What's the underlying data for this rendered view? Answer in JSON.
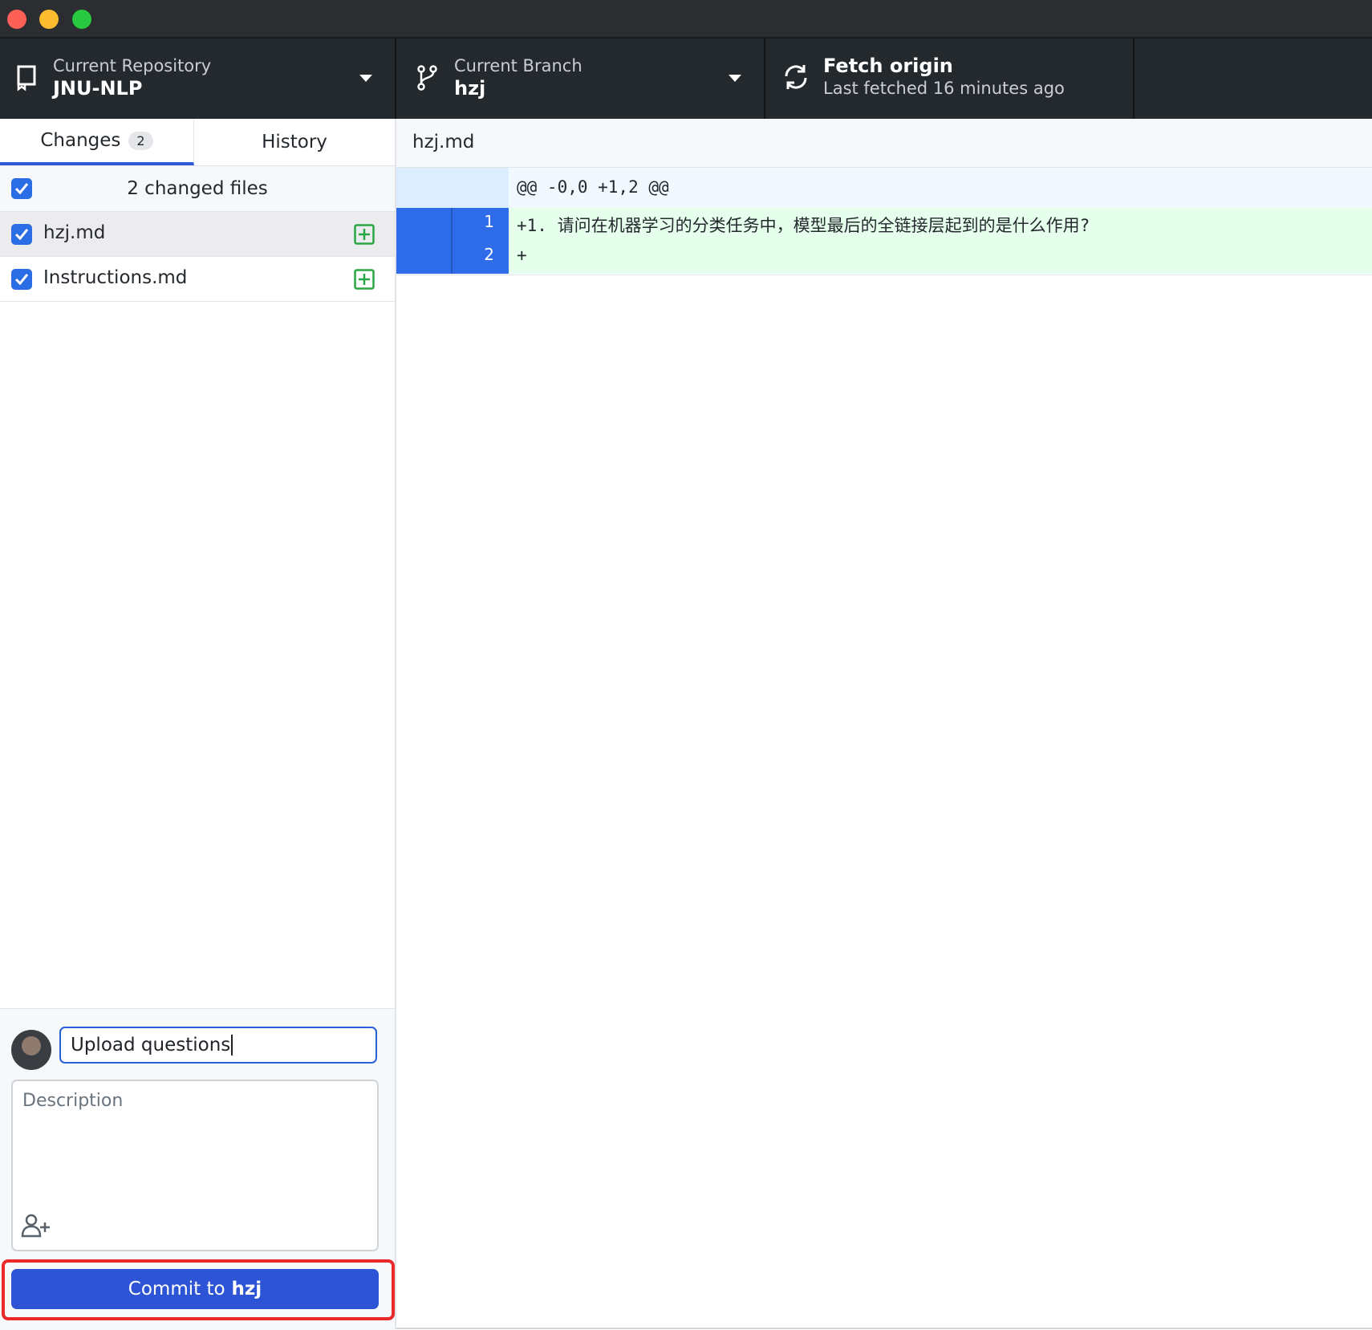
{
  "toolbar": {
    "repository": {
      "caption": "Current Repository",
      "value": "JNU-NLP",
      "icon": "repo-icon"
    },
    "branch": {
      "caption": "Current Branch",
      "value": "hzj",
      "icon": "branch-icon"
    },
    "fetch": {
      "title": "Fetch origin",
      "subtitle": "Last fetched 16 minutes ago",
      "icon": "sync-icon"
    }
  },
  "sidebar": {
    "tabs": [
      {
        "label": "Changes",
        "badge": "2",
        "active": true
      },
      {
        "label": "History",
        "active": false
      }
    ],
    "changes_header": "2 changed files",
    "files": [
      {
        "name": "hzj.md",
        "status": "added",
        "checked": true,
        "selected": true
      },
      {
        "name": "Instructions.md",
        "status": "added",
        "checked": true,
        "selected": false
      }
    ]
  },
  "commit": {
    "summary_value": "Upload questions",
    "description_placeholder": "Description",
    "button_prefix": "Commit to",
    "button_branch": "hzj"
  },
  "diff": {
    "filename": "hzj.md",
    "hunk_header": "@@ -0,0 +1,2 @@",
    "lines": [
      {
        "new_line": "1",
        "text": "+1. 请问在机器学习的分类任务中，模型最后的全链接层起到的是什么作用?"
      },
      {
        "new_line": "2",
        "text": "+"
      }
    ]
  },
  "colors": {
    "toolbar_bg": "#24292e",
    "accent_blue": "#2c54d4",
    "added_green": "#28a745",
    "diff_added_bg": "#e6ffed",
    "highlight_red": "#ea2a2a"
  }
}
